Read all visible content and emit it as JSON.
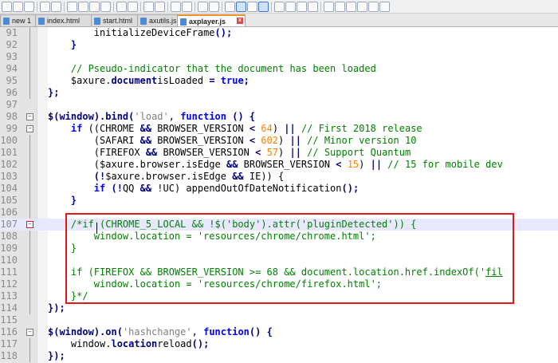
{
  "toolbar": {
    "icons": [
      "new-file-icon",
      "open-icon",
      "save-icon",
      "save-all-icon",
      "close-icon",
      "close-all-icon",
      "print-icon",
      "cut-icon",
      "copy-icon",
      "paste-icon",
      "undo-icon",
      "redo-icon",
      "find-icon",
      "replace-icon",
      "zoom-in-icon",
      "zoom-out-icon",
      "sync-v-icon",
      "sync-h-icon",
      "wrap-icon",
      "all-chars-icon",
      "indent-guide-icon",
      "udl-icon",
      "doc-map-icon",
      "function-list-icon",
      "folder-workspace-icon",
      "monitor-icon",
      "record-icon",
      "stop-icon",
      "play-icon",
      "play-multiple-icon",
      "save-macro-icon"
    ]
  },
  "tabs": [
    {
      "label": "new 1",
      "active": false
    },
    {
      "label": "index.html",
      "active": false
    },
    {
      "label": "start.html",
      "active": false
    },
    {
      "label": "axutils.js",
      "active": false
    },
    {
      "label": "axplayer.js",
      "active": true
    }
  ],
  "lines": [
    {
      "n": "91"
    },
    {
      "n": "92"
    },
    {
      "n": "93"
    },
    {
      "n": "94"
    },
    {
      "n": "95"
    },
    {
      "n": "96"
    },
    {
      "n": "97"
    },
    {
      "n": "98"
    },
    {
      "n": "99"
    },
    {
      "n": "100"
    },
    {
      "n": "101"
    },
    {
      "n": "102"
    },
    {
      "n": "103"
    },
    {
      "n": "104"
    },
    {
      "n": "105"
    },
    {
      "n": "106"
    },
    {
      "n": "107"
    },
    {
      "n": "108"
    },
    {
      "n": "109"
    },
    {
      "n": "110"
    },
    {
      "n": "111"
    },
    {
      "n": "112"
    },
    {
      "n": "113"
    },
    {
      "n": "114"
    },
    {
      "n": "115"
    },
    {
      "n": "116"
    },
    {
      "n": "117"
    },
    {
      "n": "118"
    }
  ],
  "code": {
    "l91_a": "initializeDeviceFrame",
    "l91_b": "();",
    "l92": "}",
    "l94": "// Pseudo-indicator that the document has been loaded",
    "l95_a": "$axure.",
    "l95_b": "document",
    ".": ".",
    "l95_c": "isLoaded ",
    "l95_d": "=",
    "l95_e": " true",
    ";": ";",
    "l96": "};",
    "l98_a": "$(",
    "l98_b": "window",
    "l98_c": ").bind(",
    "l98_d": "'load'",
    "l98_e": ", ",
    "l98_f": "function",
    "l98_g": " () {",
    "l99_a": "if",
    "l99_b": " ((CHROME ",
    "l99_c": "&&",
    "l99_d": " BROWSER_VERSION ",
    "l99_e": "<",
    "l99_f": " 64",
    "l99_g": ") ",
    "l99_h": "||",
    "l99_i": " // First 2018 release",
    "l100_a": "(SAFARI ",
    "l100_b": "&&",
    "l100_c": " BROWSER_VERSION ",
    "l100_d": "<",
    "l100_e": " 602",
    "l100_f": ") ",
    "l100_g": "||",
    "l100_h": " // Minor version 10",
    "l101_a": "(FIREFOX ",
    "l101_b": "&&",
    "l101_c": " BROWSER_VERSION ",
    "l101_d": "<",
    "l101_e": " 57",
    "l101_f": ") ",
    "l101_g": "||",
    "l101_h": " // Support Quantum",
    "l102_a": "($axure.browser.isEdge ",
    "l102_b": "&&",
    "l102_c": " BROWSER_VERSION ",
    "l102_d": "<",
    "l102_e": " 15",
    "l102_f": ") ",
    "l102_g": "||",
    "l102_h": " // 15 for mobile dev",
    "l103_a": "(!",
    "l103_b": "$axure.browser.isEdge ",
    "l103_c": "&&",
    "l103_d": " IE)) {",
    "l104_a": "if",
    "l104_b": " (!",
    "l104_c": "QQ ",
    "l104_d": "&&",
    "l104_e": " !UC) appendOutOfDateNotification",
    "l104_f": "();",
    "l105": "}",
    "l107_a": "/*",
    "l107_b": "if (CHROME_5_LOCAL && !$('body').attr('pluginDetected')) {",
    "l108": "window.location = 'resources/chrome/chrome.html';",
    "l109": "}",
    "l111_a": "if (FIREFOX && BROWSER_VERSION >= 68 && document.location.href.indexOf('",
    "l111_b": "fil",
    "l112": "window.location = 'resources/chrome/firefox.html';",
    "l113": "}*/",
    "l114": "});",
    "l116_a": "$(",
    "l116_b": "window",
    "l116_c": ").on(",
    "l116_d": "'hashchange'",
    "l116_e": ", ",
    "l116_f": "function",
    "l116_g": "() {",
    "l117_a": "window.",
    "l117_b": "location",
    "l117_c": "reload",
    "l117_d": "();",
    "l118": "});"
  },
  "colors": {
    "highlight_box": "#e01818",
    "keyword": "#0000ff",
    "comment": "#008000",
    "number": "#ff8000",
    "string": "#808080"
  }
}
